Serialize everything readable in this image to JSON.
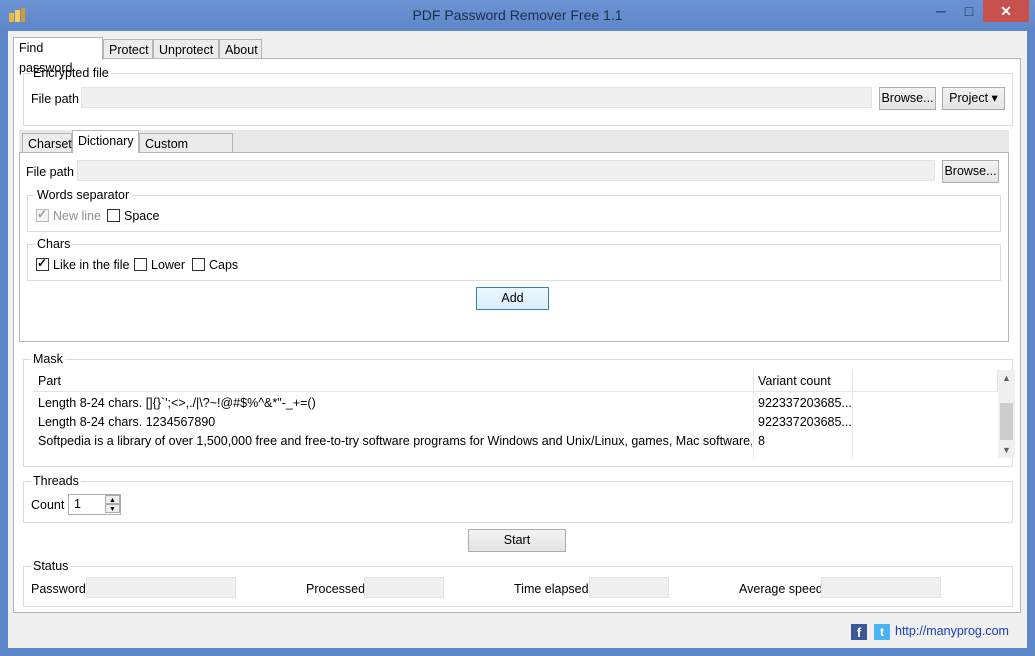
{
  "window": {
    "title": "PDF Password Remover Free 1.1",
    "minimize": "─",
    "maximize": "□",
    "close": "✕"
  },
  "main_tabs": [
    {
      "label": "Find password"
    },
    {
      "label": "Protect"
    },
    {
      "label": "Unprotect"
    },
    {
      "label": "About"
    }
  ],
  "encrypted_file": {
    "group_title": "Encrypted file",
    "file_path_label": "File path",
    "file_path_value": "",
    "browse_label": "Browse...",
    "project_label": "Project ▾"
  },
  "sub_tabs": [
    {
      "label": "Charset"
    },
    {
      "label": "Dictionary"
    },
    {
      "label": "Custom variants"
    }
  ],
  "dictionary": {
    "file_path_label": "File path",
    "file_path_value": "",
    "browse_label": "Browse...",
    "words_separator": {
      "title": "Words separator",
      "new_line": "New line",
      "space": "Space"
    },
    "chars": {
      "title": "Chars",
      "like_in_file": "Like in the file",
      "lower": "Lower",
      "caps": "Caps"
    },
    "add_label": "Add"
  },
  "mask": {
    "group_title": "Mask",
    "columns": [
      "Part",
      "Variant count"
    ],
    "rows": [
      {
        "part": "Length 8-24 chars. []{}`';<>,./|\\?~!@#$%^&*\"-_+=()",
        "count": "922337203685..."
      },
      {
        "part": "Length 8-24 chars. 1234567890",
        "count": "922337203685..."
      },
      {
        "part": "Softpedia is a library of over 1,500,000 free and free-to-try software programs for Windows and Unix/Linux, games, Mac software, Win...",
        "count": "8"
      }
    ]
  },
  "threads": {
    "group_title": "Threads",
    "count_label": "Count",
    "count_value": "1"
  },
  "start_label": "Start",
  "status": {
    "group_title": "Status",
    "password_label": "Password",
    "processed_label": "Processed",
    "time_elapsed_label": "Time elapsed",
    "average_speed_label": "Average speed"
  },
  "footer": {
    "link": "http://manyprog.com",
    "facebook_glyph": "f",
    "twitter_glyph": "t"
  },
  "colors": {
    "titlebar": "#5d86c9",
    "close": "#c7504c",
    "accent_border": "#3c7fb1"
  }
}
